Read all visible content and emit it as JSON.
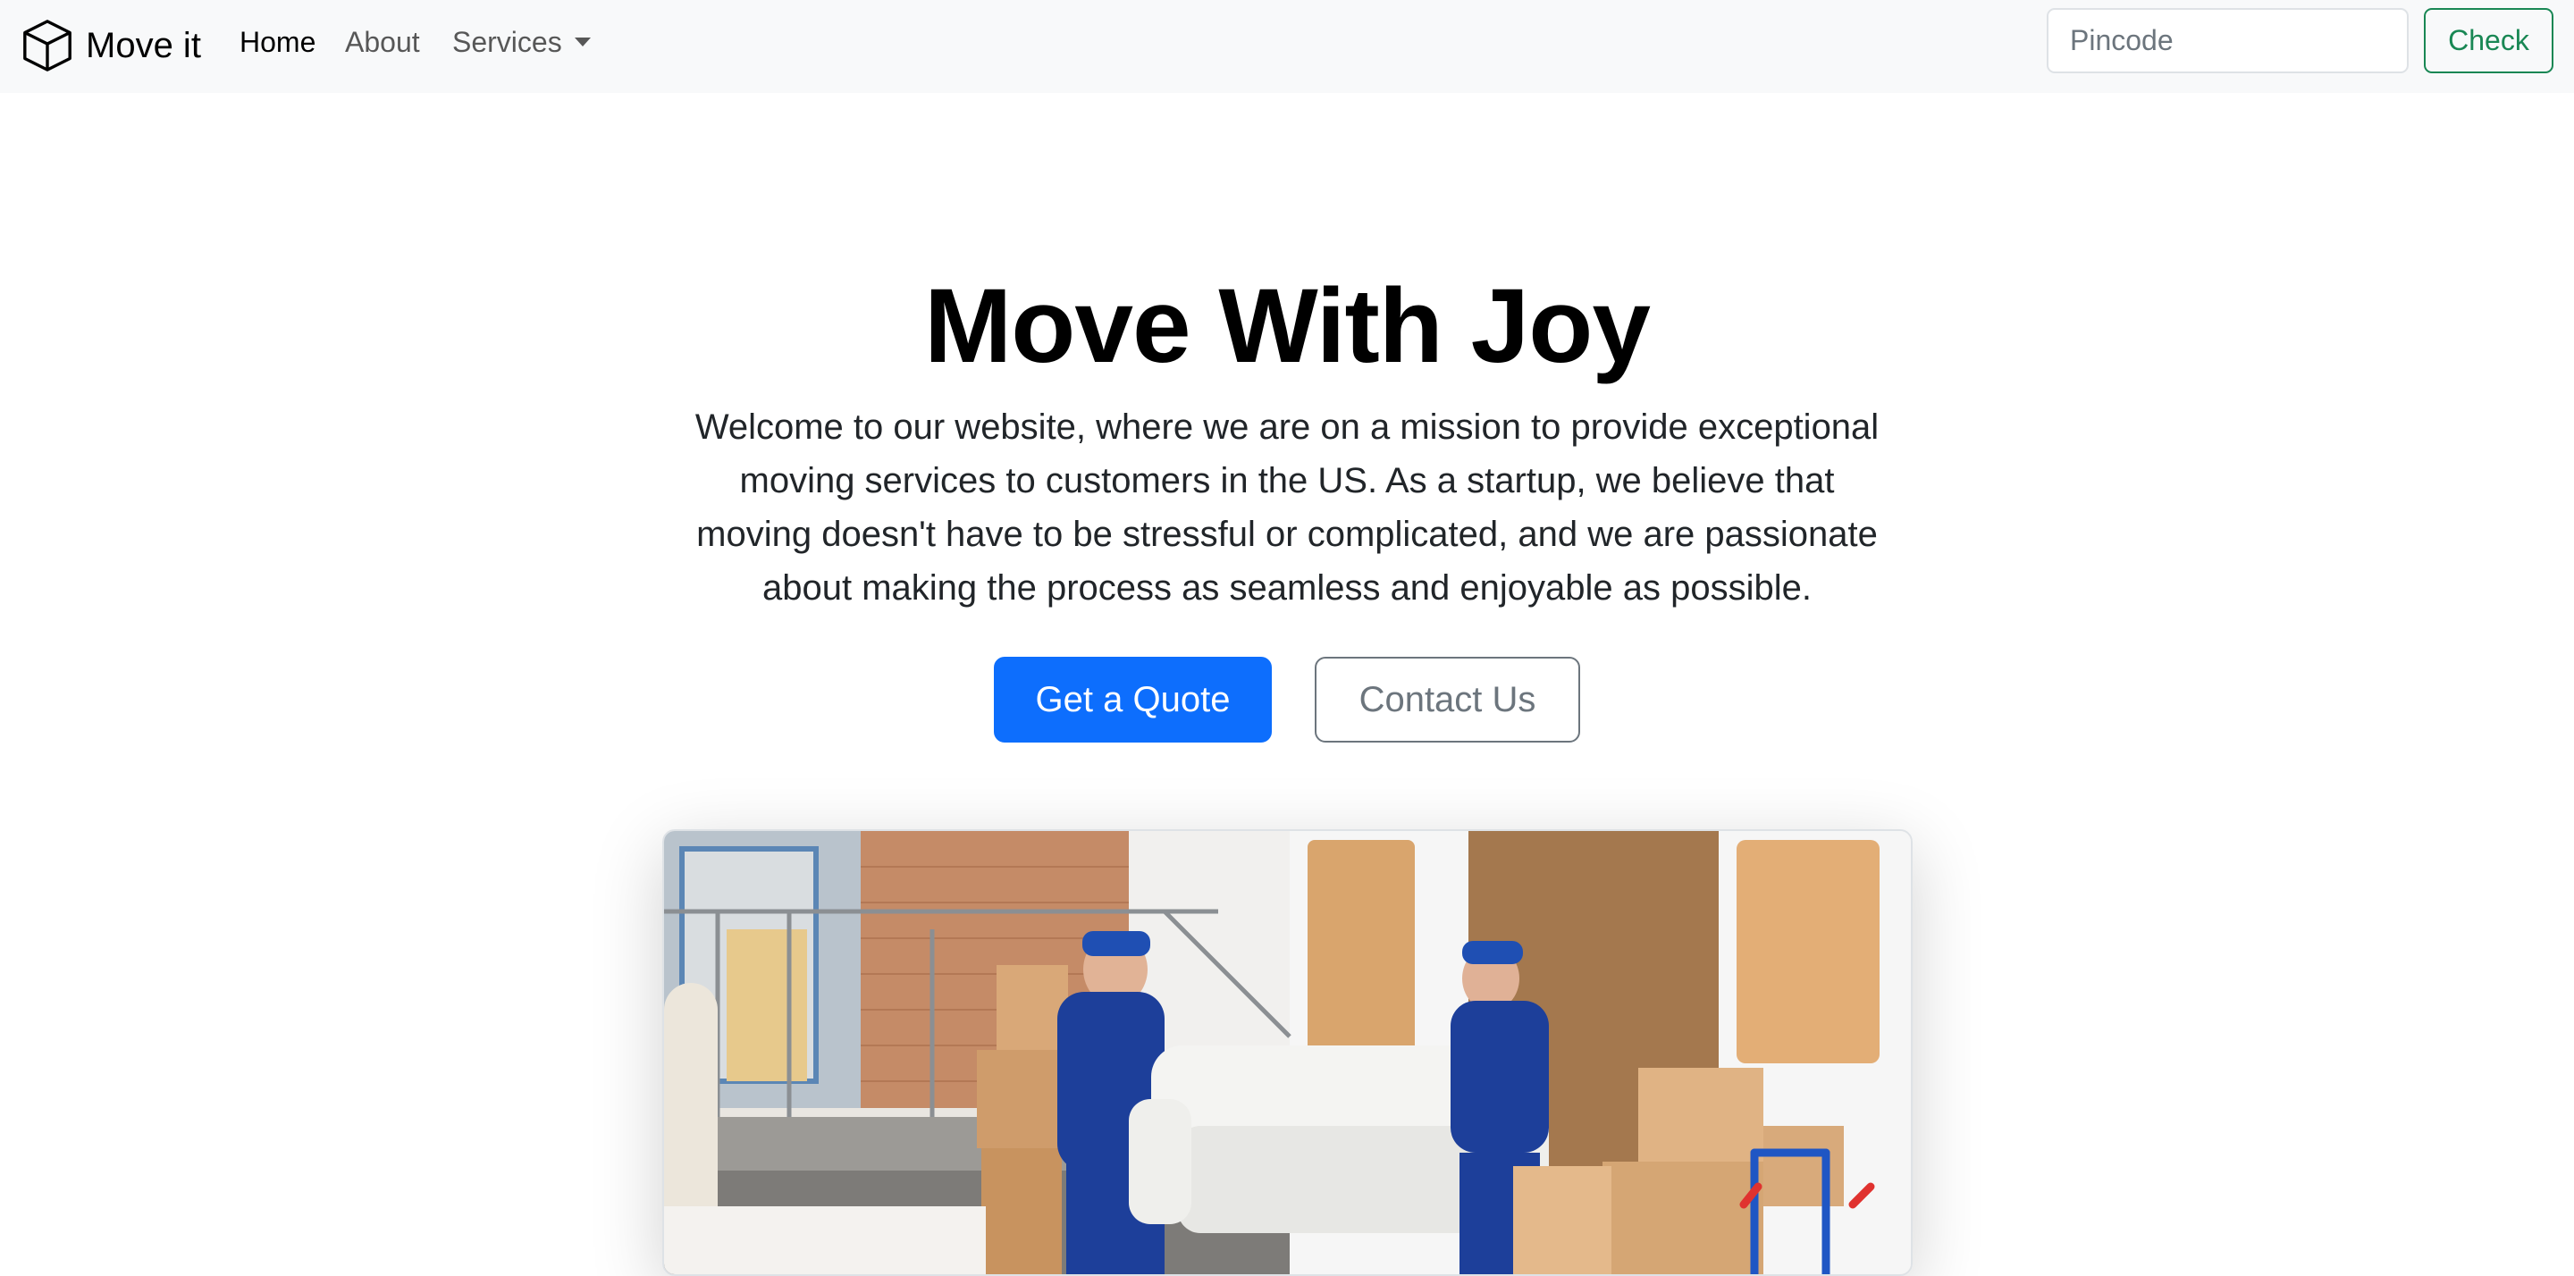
{
  "navbar": {
    "brand": {
      "icon": "box-icon",
      "name": "Move it"
    },
    "links": [
      {
        "label": "Home",
        "active": true
      },
      {
        "label": "About",
        "active": false
      },
      {
        "label": "Services",
        "active": false,
        "dropdown": true
      }
    ],
    "search": {
      "placeholder": "Pincode",
      "value": ""
    },
    "check_label": "Check"
  },
  "hero": {
    "title": "Move With Joy",
    "description": "Welcome to our website, where we are on a mission to provide exceptional moving services to customers in the US. As a startup, we believe that moving doesn't have to be stressful or complicated, and we are passionate about making the process as seamless and enjoyable as possible.",
    "primary_button": "Get a Quote",
    "secondary_button": "Contact Us",
    "image": {
      "subject": "Two movers in blue uniforms carrying a white sofa beside a van with cardboard boxes"
    }
  },
  "colors": {
    "primary": "#0d6efd",
    "success": "#198754",
    "secondary": "#6c757d",
    "navbar_bg": "#f8f9fa"
  }
}
